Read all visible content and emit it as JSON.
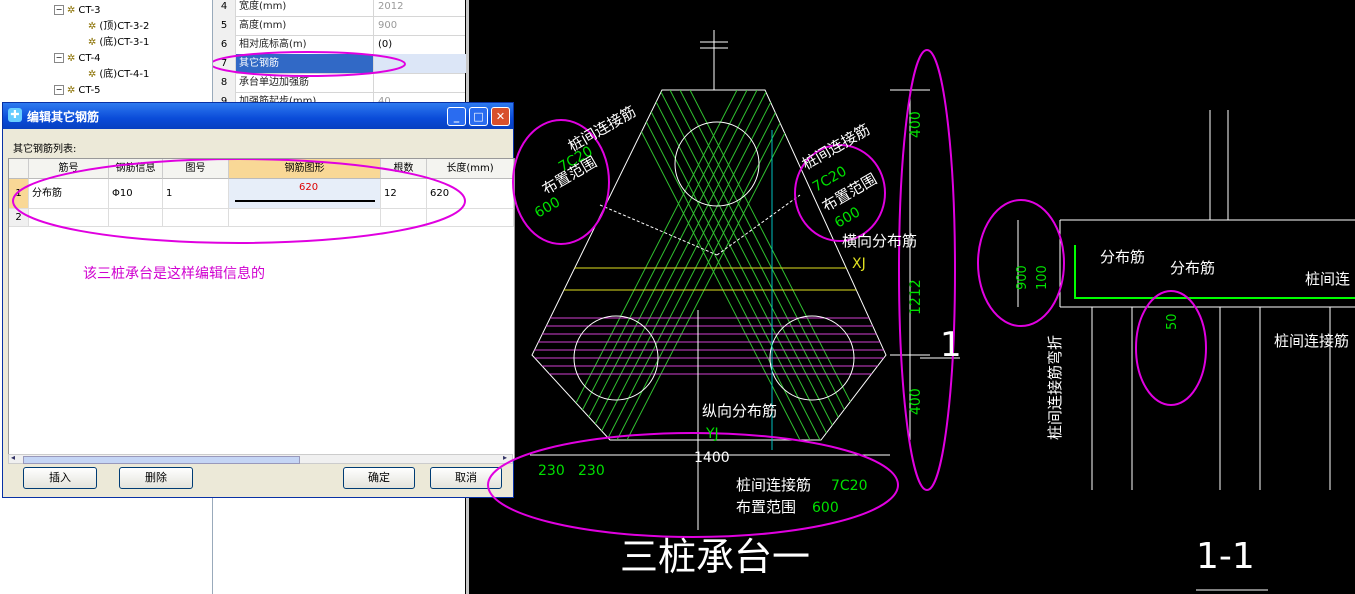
{
  "tree": {
    "items": [
      {
        "label": "CT-3",
        "level": 0
      },
      {
        "label": "(顶)CT-3-2",
        "level": 1
      },
      {
        "label": "(底)CT-3-1",
        "level": 1
      },
      {
        "label": "CT-4",
        "level": 0
      },
      {
        "label": "(底)CT-4-1",
        "level": 1
      },
      {
        "label": "CT-5",
        "level": 0
      }
    ]
  },
  "properties": {
    "rows": [
      {
        "num": "4",
        "name": "宽度(mm)",
        "value": "2012"
      },
      {
        "num": "5",
        "name": "高度(mm)",
        "value": "900"
      },
      {
        "num": "6",
        "name": "相对底标高(m)",
        "value": "(0)"
      },
      {
        "num": "7",
        "name": "其它钢筋",
        "value": ""
      },
      {
        "num": "8",
        "name": "承台单边加强筋",
        "value": ""
      },
      {
        "num": "9",
        "name": "加强筋起步(mm)",
        "value": "40"
      }
    ]
  },
  "dialog": {
    "title": "编辑其它钢筋",
    "list_label": "其它钢筋列表:",
    "columns": [
      "筋号",
      "钢筋信息",
      "图号",
      "钢筋图形",
      "根数",
      "长度(mm)"
    ],
    "rows": [
      {
        "num": "1",
        "name": "分布筋",
        "info": "Φ10",
        "fig": "1",
        "shape_value": "620",
        "count": "12",
        "length": "620"
      },
      {
        "num": "2",
        "name": "",
        "info": "",
        "fig": "",
        "shape_value": "",
        "count": "",
        "length": ""
      }
    ],
    "buttons": {
      "insert": "插入",
      "delete": "删除",
      "ok": "确定",
      "cancel": "取消"
    },
    "note": "该三桩承台是这样编辑信息的"
  },
  "cad": {
    "title_main": "三桩承台一",
    "title_section": "1-1",
    "section_marker": "1",
    "label_link_left": "桩间连接筋",
    "label_link_left_spec": "7C20",
    "label_range_left": "布置范围",
    "label_range_left_val": "600",
    "label_link_right": "桩间连接筋",
    "label_link_right_spec": "7C20",
    "label_range_right": "布置范围",
    "label_range_right_val": "600",
    "label_transverse": "横向分布筋",
    "label_xj": "XJ",
    "label_longitudinal": "纵向分布筋",
    "label_yj": "YJ",
    "dim_400_top": "400",
    "dim_1212": "1212",
    "dim_400_bot": "400",
    "dim_230a": "230",
    "dim_230b": "230",
    "dim_1400": "1400",
    "label_link_bottom": "桩间连接筋",
    "label_link_bottom_spec": "7C20",
    "label_range_bottom": "布置范围",
    "label_range_bottom_val": "600",
    "sec_dim_900": "900",
    "sec_dim_100": "100",
    "sec_dim_50": "50",
    "sec_label_dist1": "分布筋",
    "sec_label_dist2": "分布筋",
    "sec_label_link1": "桩间连",
    "sec_label_link2": "桩间连接筋",
    "sec_label_vertical": "桩间连接筋弯折"
  },
  "colors": {
    "annotation": "#e000e0",
    "rebar": "#00ff00",
    "cad_white": "#ffffff",
    "dim_green": "#00e000"
  }
}
